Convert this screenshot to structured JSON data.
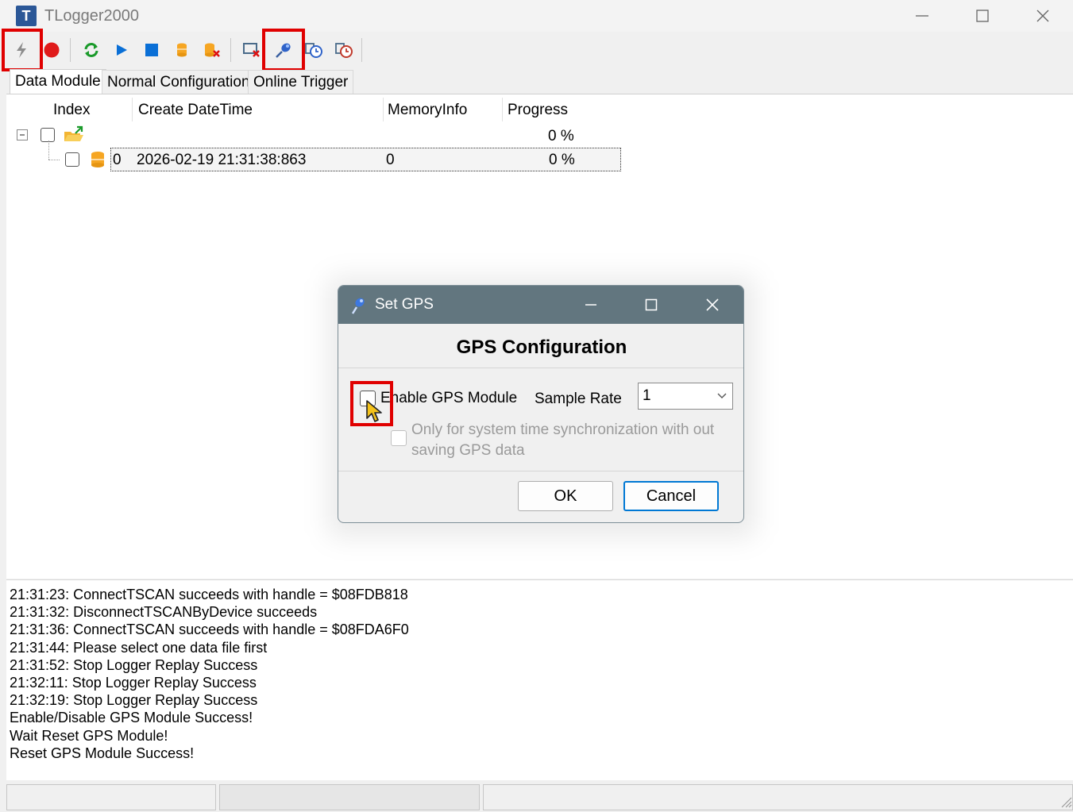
{
  "window": {
    "title": "TLogger2000",
    "icon_letter": "T"
  },
  "toolbar": {
    "items": [
      {
        "name": "connect-icon"
      },
      {
        "name": "record-icon"
      },
      {
        "name": "refresh-icon"
      },
      {
        "name": "play-icon"
      },
      {
        "name": "stop-icon"
      },
      {
        "name": "database-icon"
      },
      {
        "name": "database-delete-icon"
      },
      {
        "name": "disconnect-icon"
      },
      {
        "name": "gps-pin-icon"
      },
      {
        "name": "clock-icon"
      },
      {
        "name": "clock-settings-icon"
      }
    ]
  },
  "tabs": [
    "Data Module",
    "Normal Configuration",
    "Online Trigger"
  ],
  "grid": {
    "columns": [
      "Index",
      "Create DateTime",
      "MemoryInfo",
      "Progress"
    ],
    "root_progress": "0 %",
    "rows": [
      {
        "index": "0",
        "datetime": "2026-02-19 21:31:38:863",
        "memory": "0",
        "progress": "0 %"
      }
    ]
  },
  "log": [
    "21:31:23: ConnectTSCAN succeeds with handle = $08FDB818",
    "21:31:32: DisconnectTSCANByDevice succeeds",
    "21:31:36: ConnectTSCAN succeeds with handle = $08FDA6F0",
    "21:31:44: Please select one data file first",
    "21:31:52: Stop Logger Replay Success",
    "21:32:11: Stop Logger Replay Success",
    "21:32:19: Stop Logger Replay Success",
    "Enable/Disable GPS Module Success!",
    "Wait Reset GPS Module!",
    "Reset GPS Module Success!"
  ],
  "dialog": {
    "title": "Set GPS",
    "heading": "GPS Configuration",
    "enable_label": "Enable GPS Module",
    "sample_rate_label": "Sample Rate",
    "sample_rate_value": "1",
    "sync_only_label_line1": "Only for system time synchronization with out",
    "sync_only_label_line2": "saving GPS data",
    "ok_label": "OK",
    "cancel_label": "Cancel"
  },
  "colors": {
    "dialog_titlebar": "#62767f",
    "highlight": "#e00000",
    "accent_blue": "#0078d4"
  }
}
